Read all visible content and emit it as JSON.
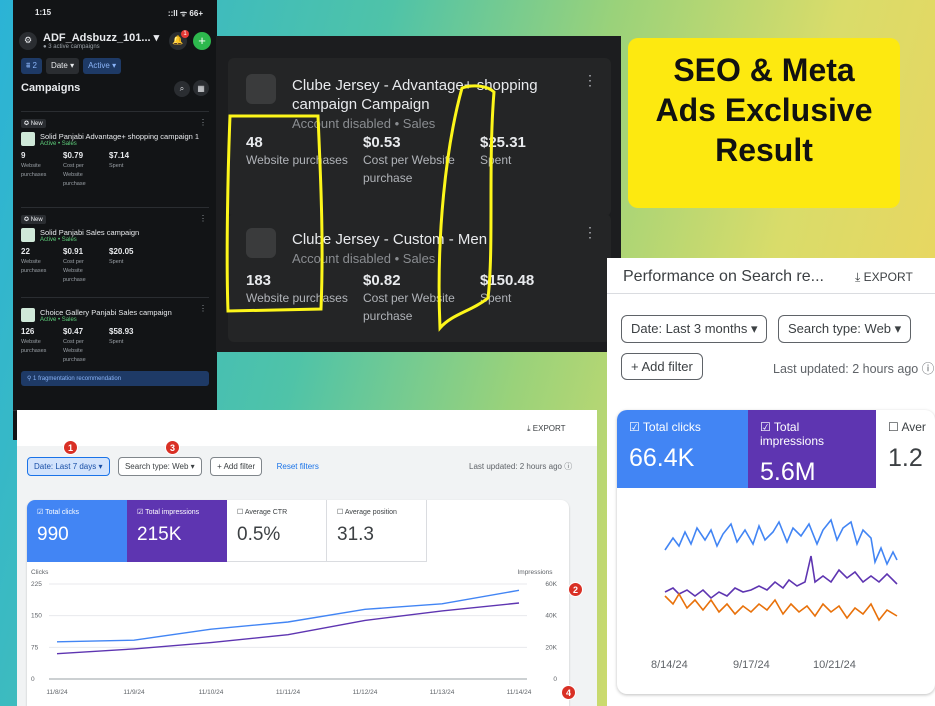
{
  "phone": {
    "time": "1:15",
    "status_icons": "::ll ᯤ 66+",
    "account_name": "ADF_Adsbuzz_101...",
    "account_sub": "● 3 active campaigns",
    "bell_badge": "1",
    "filter_count": "⩩ 2",
    "filter_date": "Date ▾",
    "filter_active": "Active ▾",
    "campaigns_title": "Campaigns",
    "campaigns": [
      {
        "badge": "✪ New",
        "name": "Solid Panjabi Advantage+ shopping campaign 1",
        "status": "Active • Sales",
        "m1": "9",
        "m1l": "Website purchases",
        "m2": "$0.79",
        "m2l": "Cost per Website purchase",
        "m3": "$7.14",
        "m3l": "Spent"
      },
      {
        "badge": "✪ New",
        "name": "Solid Panjabi Sales campaign",
        "status": "Active • Sales",
        "m1": "22",
        "m1l": "Website purchases",
        "m2": "$0.91",
        "m2l": "Cost per Website purchase",
        "m3": "$20.05",
        "m3l": "Spent"
      },
      {
        "badge": "",
        "name": "Choice Gallery Panjabi Sales campaign",
        "status": "Active • Sales",
        "m1": "126",
        "m1l": "Website purchases",
        "m2": "$0.47",
        "m2l": "Cost per Website purchase",
        "m3": "$58.93",
        "m3l": "Spent"
      }
    ],
    "recommendation": "⚲ 1 fragmentation recommendation"
  },
  "meta": {
    "cards": [
      {
        "title": "Clube Jersey - Advantage+ shopping campaign Campaign",
        "sub": "Account disabled • Sales",
        "m1": "48",
        "m1l": "Website purchases",
        "m2": "$0.53",
        "m2l": "Cost per Website purchase",
        "m3": "$25.31",
        "m3l": "Spent"
      },
      {
        "title": "Clube Jersey - Custom - Men",
        "sub": "Account disabled • Sales",
        "m1": "183",
        "m1l": "Website purchases",
        "m2": "$0.82",
        "m2l": "Cost per Website purchase",
        "m3": "$150.48",
        "m3l": "Spent"
      }
    ]
  },
  "label": {
    "line1": "SEO & Meta",
    "line2": "Ads Exclusive",
    "line3": "Result"
  },
  "gsc_right": {
    "title": "Performance on Search re...",
    "export": "EXPORT",
    "date_filter": "Date: Last 3 months",
    "type_filter": "Search type: Web",
    "add_filter": "Add filter",
    "updated": "Last updated: 2 hours ago",
    "clicks_label": "Total clicks",
    "clicks_value": "66.4K",
    "impr_label": "Total impressions",
    "impr_value": "5.6M",
    "avg_label": "Aver",
    "avg_value": "1.2",
    "x_ticks": [
      "8/14/24",
      "9/17/24",
      "10/21/24"
    ]
  },
  "gsc_bottom": {
    "export": "EXPORT",
    "date_filter": "Date: Last 7 days",
    "type_filter": "Search type: Web",
    "add_filter": "Add filter",
    "reset": "Reset filters",
    "updated": "Last updated: 2 hours ago",
    "clicks_label": "Total clicks",
    "clicks_value": "990",
    "impr_label": "Total impressions",
    "impr_value": "215K",
    "ctr_label": "Average CTR",
    "ctr_value": "0.5%",
    "pos_label": "Average position",
    "pos_value": "31.3",
    "markers": [
      "1",
      "2",
      "3",
      "4"
    ]
  },
  "chart_data": {
    "type": "line",
    "x": [
      "11/8/24",
      "11/9/24",
      "11/10/24",
      "11/11/24",
      "11/12/24",
      "11/13/24",
      "11/14/24"
    ],
    "series": [
      {
        "name": "Clicks",
        "axis": "left",
        "values": [
          88,
          92,
          118,
          135,
          165,
          178,
          210
        ]
      },
      {
        "name": "Impressions",
        "axis": "right",
        "values": [
          16000,
          19000,
          23000,
          28000,
          37000,
          43000,
          48000
        ]
      }
    ],
    "ylabel": "Clicks",
    "y2label": "Impressions",
    "y_ticks": [
      "225",
      "150",
      "75",
      "0"
    ],
    "y2_ticks": [
      "60K",
      "40K",
      "20K",
      "0"
    ],
    "ylim": [
      0,
      225
    ],
    "y2lim": [
      0,
      60000
    ],
    "grid": true,
    "colors": {
      "clicks": "#4285f4",
      "impressions": "#5e35b1"
    }
  }
}
